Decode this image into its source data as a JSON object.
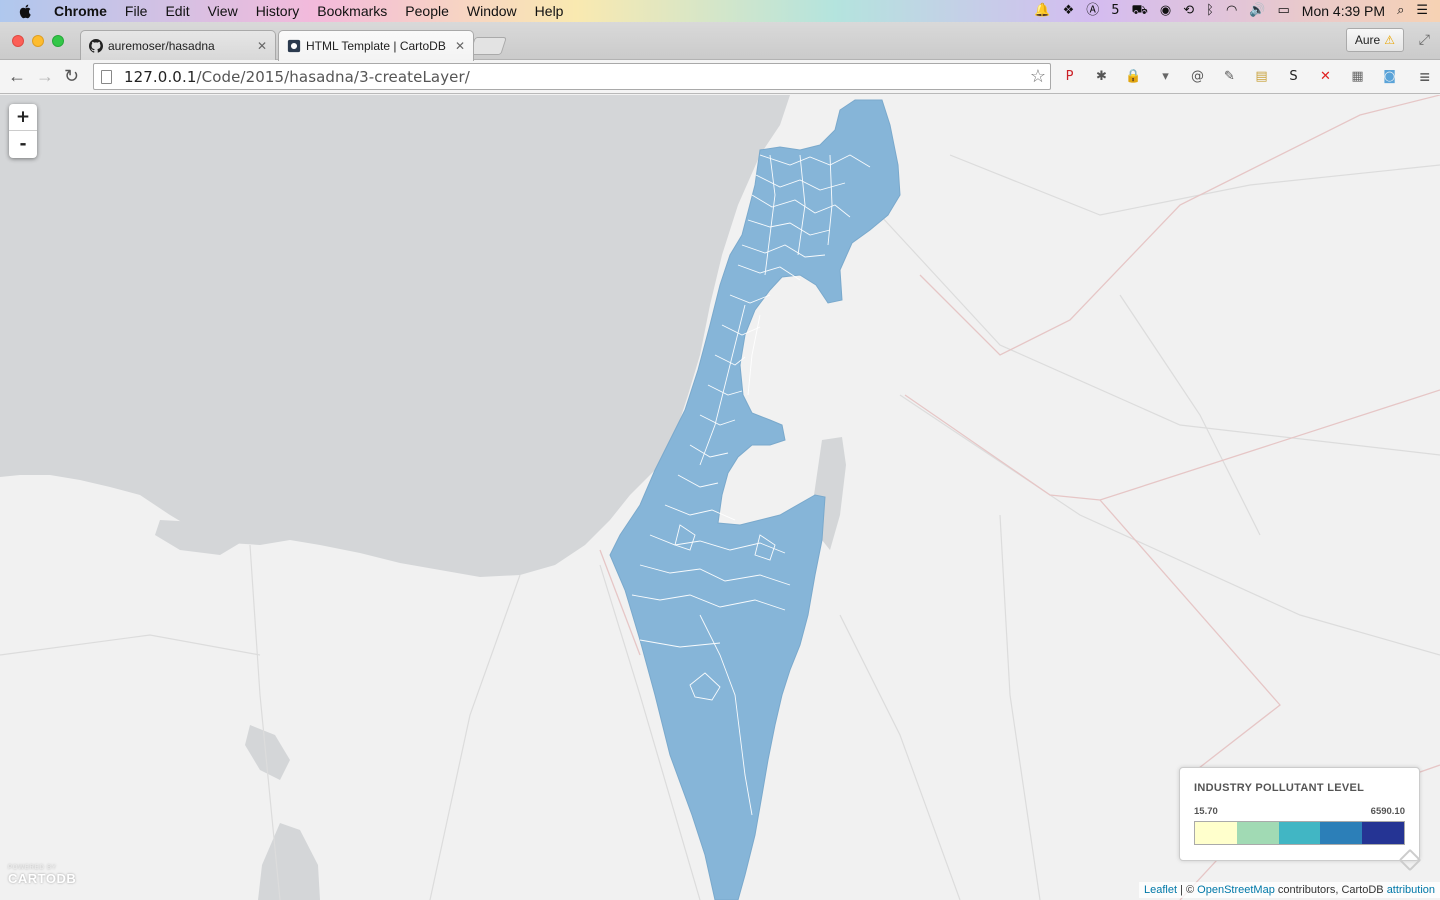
{
  "menubar": {
    "items": [
      "Chrome",
      "File",
      "Edit",
      "View",
      "History",
      "Bookmarks",
      "People",
      "Window",
      "Help"
    ],
    "status": {
      "badge_count": "5",
      "clock": "Mon 4:39 PM"
    }
  },
  "tabs": [
    {
      "title": "auremoser/hasadna",
      "active": false,
      "icon": "github-icon"
    },
    {
      "title": "HTML Template | CartoDB",
      "active": true,
      "icon": "cartodb-icon"
    }
  ],
  "profile": {
    "name": "Aure"
  },
  "address": {
    "host": "127.0.0.1",
    "path": "/Code/2015/hasadna/3-createLayer/"
  },
  "extensions": [
    {
      "name": "pinterest-icon",
      "glyph": "P",
      "color": "#cb2027"
    },
    {
      "name": "asterisk-icon",
      "glyph": "✱",
      "color": "#555555"
    },
    {
      "name": "lock-icon",
      "glyph": "🔒",
      "color": "#2b3a67"
    },
    {
      "name": "pocket-icon",
      "glyph": "▾",
      "color": "#666666"
    },
    {
      "name": "at-icon",
      "glyph": "@",
      "color": "#555555"
    },
    {
      "name": "eyedropper-icon",
      "glyph": "✎",
      "color": "#555555"
    },
    {
      "name": "notepad-icon",
      "glyph": "▤",
      "color": "#c9a23c"
    },
    {
      "name": "screenshot-icon",
      "glyph": "S",
      "color": "#222222"
    },
    {
      "name": "x-icon",
      "glyph": "✕",
      "color": "#e02020"
    },
    {
      "name": "grid-icon",
      "glyph": "▦",
      "color": "#666666"
    },
    {
      "name": "camera-icon",
      "glyph": "◙",
      "color": "#5aa3d8"
    }
  ],
  "map": {
    "zoom_in": "+",
    "zoom_out": "-",
    "fill_color": "#86b5d8",
    "water_color": "#d4d6d8",
    "legend": {
      "title": "INDUSTRY POLLUTANT LEVEL",
      "min": "15.70",
      "max": "6590.10",
      "colors": [
        "#ffffcc",
        "#a1dab4",
        "#41b6c4",
        "#2c7fb8",
        "#253494"
      ]
    },
    "logo": {
      "top": "POWERED BY",
      "name": "CARTODB"
    },
    "attribution": {
      "leaflet": "Leaflet",
      "sep": " | © ",
      "osm": "OpenStreetMap",
      "mid": " contributors, CartoDB ",
      "link": "attribution"
    }
  }
}
